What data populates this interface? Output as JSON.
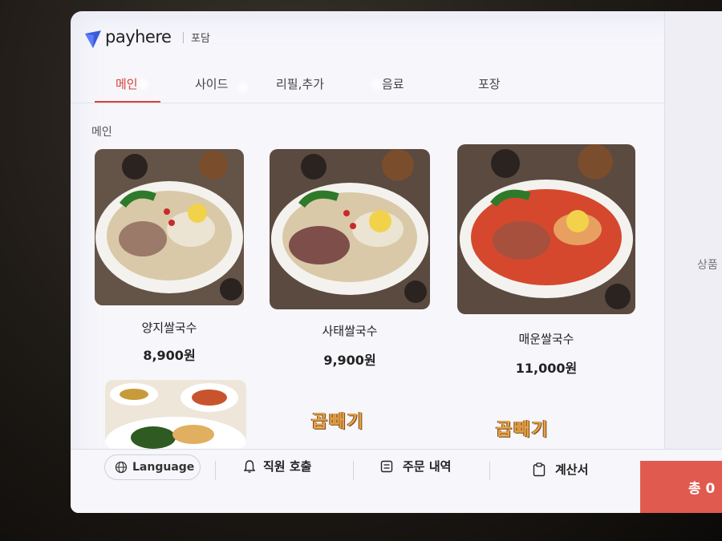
{
  "header": {
    "brand": "payhere",
    "store": "포담"
  },
  "tabs": [
    "메인",
    "사이드",
    "리필,추가",
    "음료",
    "포장"
  ],
  "section_title": "메인",
  "menu": [
    {
      "name": "양지쌀국수",
      "price": "8,900원"
    },
    {
      "name": "사태쌀국수",
      "price": "9,900원"
    },
    {
      "name": "매운쌀국수",
      "price": "11,000원"
    }
  ],
  "banners": {
    "label": "곱빼기"
  },
  "right_panel_text": "상품",
  "bottom": {
    "language": "Language",
    "call_staff": "직원 호출",
    "order_history": "주문 내역",
    "bill": "계산서",
    "total": "총 0"
  },
  "icons": [
    "globe-icon",
    "bell-icon",
    "list-icon",
    "clipboard-icon"
  ],
  "colors": {
    "accent": "#d9413a",
    "total_button": "#e05a50"
  }
}
